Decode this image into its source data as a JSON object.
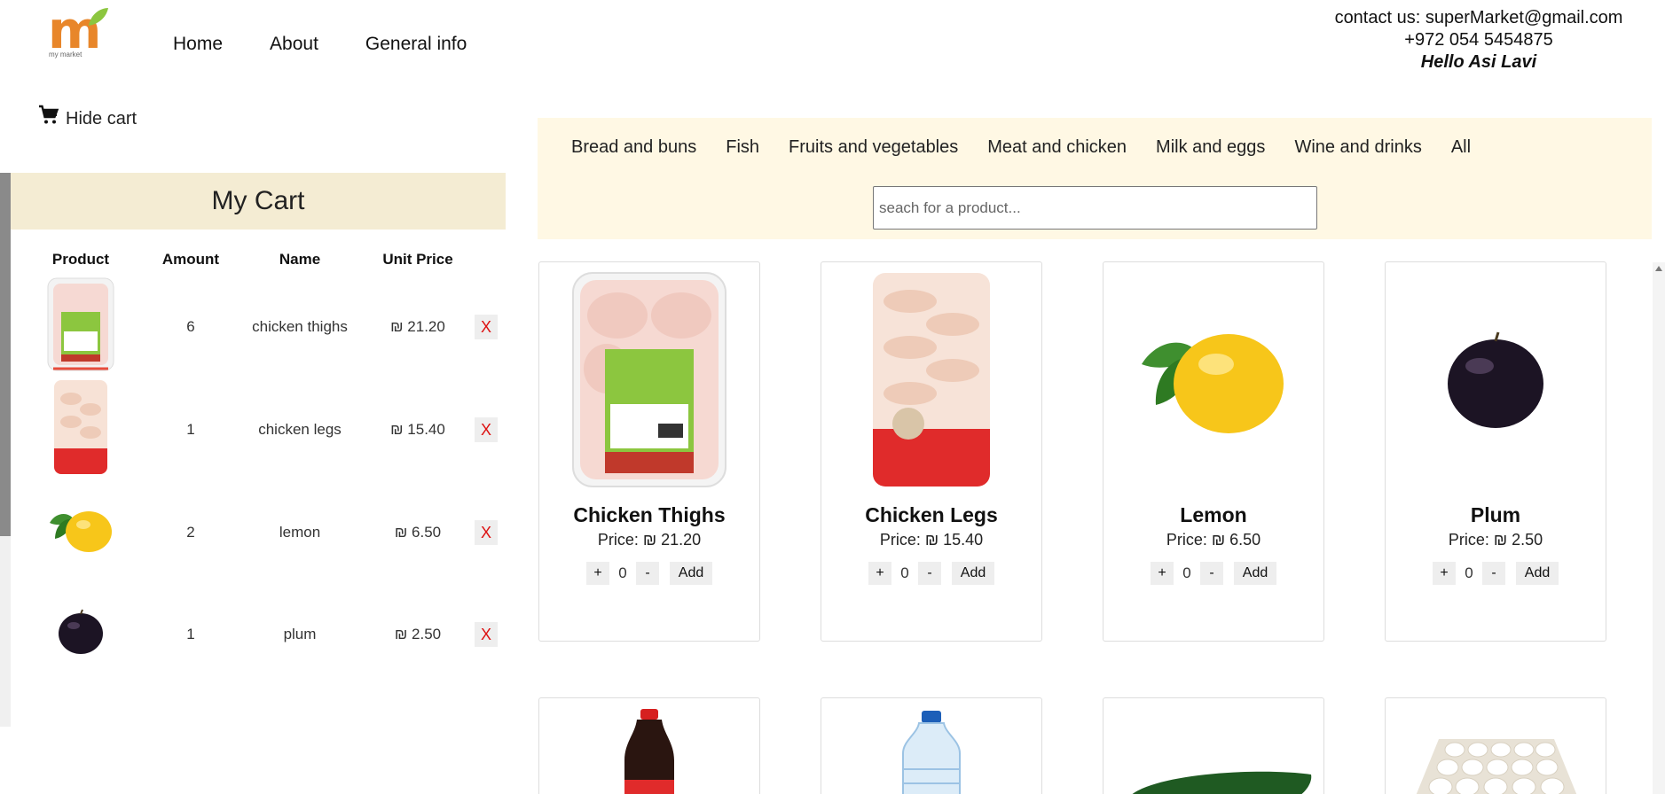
{
  "header": {
    "logo_text": "m",
    "logo_subtext": "my market",
    "nav": [
      "Home",
      "About",
      "General info"
    ],
    "contact_line": "contact us: superMarket@gmail.com",
    "phone": "+972 054 5454875",
    "greeting": "Hello Asi Lavi"
  },
  "cart": {
    "toggle_label": "Hide cart",
    "title": "My Cart",
    "columns": [
      "Product",
      "Amount",
      "Name",
      "Unit Price"
    ],
    "remove_label": "X",
    "items": [
      {
        "amount": "6",
        "name": "chicken thighs",
        "price": "₪ 21.20"
      },
      {
        "amount": "1",
        "name": "chicken legs",
        "price": "₪ 15.40"
      },
      {
        "amount": "2",
        "name": "lemon",
        "price": "₪ 6.50"
      },
      {
        "amount": "1",
        "name": "plum",
        "price": "₪ 2.50"
      }
    ]
  },
  "categories": [
    "Bread and buns",
    "Fish",
    "Fruits and vegetables",
    "Meat and chicken",
    "Milk and eggs",
    "Wine and drinks",
    "All"
  ],
  "search": {
    "placeholder": "seach for a product..."
  },
  "products": [
    {
      "name": "Chicken Thighs",
      "price": "Price: ₪ 21.20",
      "qty": "0"
    },
    {
      "name": "Chicken Legs",
      "price": "Price: ₪ 15.40",
      "qty": "0"
    },
    {
      "name": "Lemon",
      "price": "Price: ₪ 6.50",
      "qty": "0"
    },
    {
      "name": "Plum",
      "price": "Price: ₪ 2.50",
      "qty": "0"
    }
  ],
  "controls": {
    "plus": "+",
    "minus": "-",
    "add": "Add"
  },
  "colors": {
    "brand": "#e8862a",
    "cart_title_bg": "#f4ecd3",
    "category_bg": "#fff8e4",
    "remove": "#dd1111"
  }
}
